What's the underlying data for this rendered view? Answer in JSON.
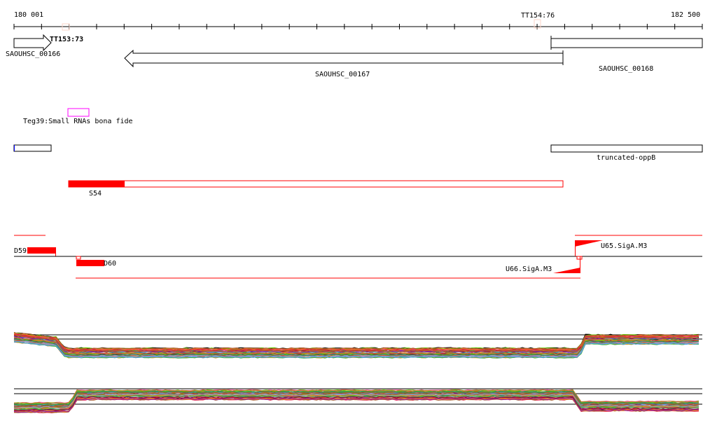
{
  "ruler": {
    "start_label": "180 001",
    "end_label": "182 500",
    "start": 180001,
    "end": 182500
  },
  "terminators": [
    {
      "label": "TT153:73"
    },
    {
      "label": "TT154:76"
    }
  ],
  "genes": [
    {
      "label": "SAOUHSC_00166",
      "strand": "+"
    },
    {
      "label": "SAOUHSC_00167",
      "strand": "-"
    },
    {
      "label": "SAOUHSC_00168",
      "strand": "+"
    }
  ],
  "srna": {
    "label": "Teg39:Small RNAs bona fide",
    "color": "#ff00ff"
  },
  "operon": {
    "label": "truncated-oppB"
  },
  "segment": {
    "label": "S54",
    "color": "#ff0000"
  },
  "features": {
    "d59": "D59",
    "d60": "D60",
    "u65": "U65.SigA.M3",
    "u66": "U66.SigA.M3"
  },
  "expression_tracks": [
    "forward",
    "reverse"
  ]
}
